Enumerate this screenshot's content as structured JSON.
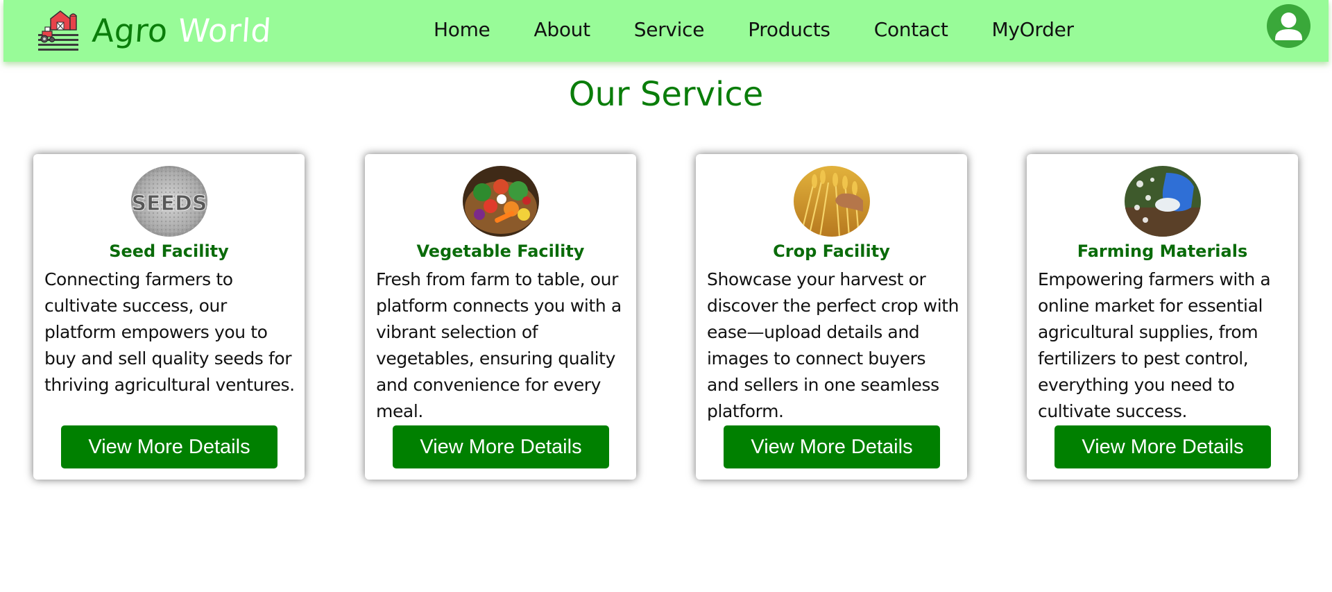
{
  "brand": {
    "name_part1": "Agro",
    "name_part2": "World",
    "logo_icon": "farm-barn-tractor-icon"
  },
  "nav": {
    "items": [
      {
        "label": "Home"
      },
      {
        "label": "About"
      },
      {
        "label": "Service"
      },
      {
        "label": "Products"
      },
      {
        "label": "Contact"
      },
      {
        "label": "MyOrder"
      }
    ],
    "profile_icon": "user-avatar-icon"
  },
  "section": {
    "title": "Our Service"
  },
  "cards": [
    {
      "image": "seeds-image",
      "title": "Seed Facility",
      "description": "Connecting farmers to cultivate success, our platform empowers you to buy and sell quality seeds for thriving agricultural ventures.",
      "button": "View More Details"
    },
    {
      "image": "vegetables-basket-image",
      "title": "Vegetable Facility",
      "description": "Fresh from farm to table, our platform connects you with a vibrant selection of vegetables, ensuring quality and convenience for every meal.",
      "button": "View More Details"
    },
    {
      "image": "wheat-crop-image",
      "title": "Crop Facility",
      "description": "Showcase your harvest or discover the perfect crop with ease—upload details and images to connect buyers and sellers in one seamless platform.",
      "button": "View More Details"
    },
    {
      "image": "fertilizer-glove-image",
      "title": "Farming Materials",
      "description": "Empowering farmers with a online market for essential agricultural supplies, from fertilizers to pest control, everything you need to cultivate success.",
      "button": "View More Details"
    }
  ],
  "colors": {
    "header_bg": "#98fb98",
    "brand_green": "#0a7d0a",
    "button_green": "#008000",
    "avatar_green": "#3aa83a"
  }
}
